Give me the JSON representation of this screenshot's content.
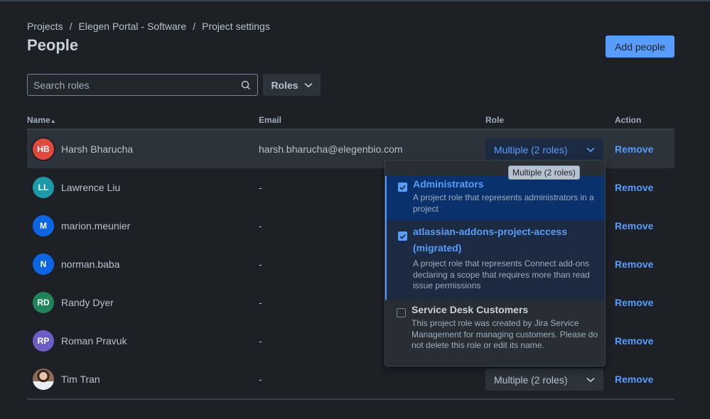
{
  "breadcrumb": [
    "Projects",
    "Elegen Portal - Software",
    "Project settings"
  ],
  "title": "People",
  "add_button": "Add people",
  "search": {
    "placeholder": "Search roles",
    "value": ""
  },
  "roles_filter": "Roles",
  "columns": {
    "name": "Name",
    "email": "Email",
    "role": "Role",
    "action": "Action"
  },
  "rows": [
    {
      "initials": "HB",
      "color": "#e2483d",
      "name": "Harsh Bharucha",
      "email": "harsh.bharucha@elegenbio.com",
      "role": "Multiple (2 roles)",
      "action": "Remove"
    },
    {
      "initials": "LL",
      "color": "#1d9aaa",
      "name": "Lawrence Liu",
      "email": "-",
      "action": "Remove"
    },
    {
      "initials": "M",
      "color": "#0c66e4",
      "name": "marion.meunier",
      "email": "-",
      "action": "Remove"
    },
    {
      "initials": "N",
      "color": "#0c66e4",
      "name": "norman.baba",
      "email": "-",
      "action": "Remove"
    },
    {
      "initials": "RD",
      "color": "#1f845a",
      "name": "Randy Dyer",
      "email": "-",
      "action": "Remove"
    },
    {
      "initials": "RP",
      "color": "#6e5dc6",
      "name": "Roman Pravuk",
      "email": "-",
      "action": "Remove"
    },
    {
      "initials": "",
      "color": "#8c6b5a",
      "name": "Tim Tran",
      "email": "-",
      "role": "Multiple (2 roles)",
      "action": "Remove"
    }
  ],
  "tooltip": "Multiple (2 roles)",
  "role_options": [
    {
      "label": "Administrators",
      "checked": true,
      "desc": "A project role that represents administrators in a project"
    },
    {
      "label": "atlassian-addons-project-access (migrated)",
      "checked": true,
      "desc": "A project role that represents Connect add-ons declaring a scope that requires more than read issue permissions"
    },
    {
      "label": "Service Desk Customers",
      "checked": false,
      "desc": "This project role was created by Jira Service Management for managing customers. Please do not delete this role or edit its name."
    }
  ]
}
